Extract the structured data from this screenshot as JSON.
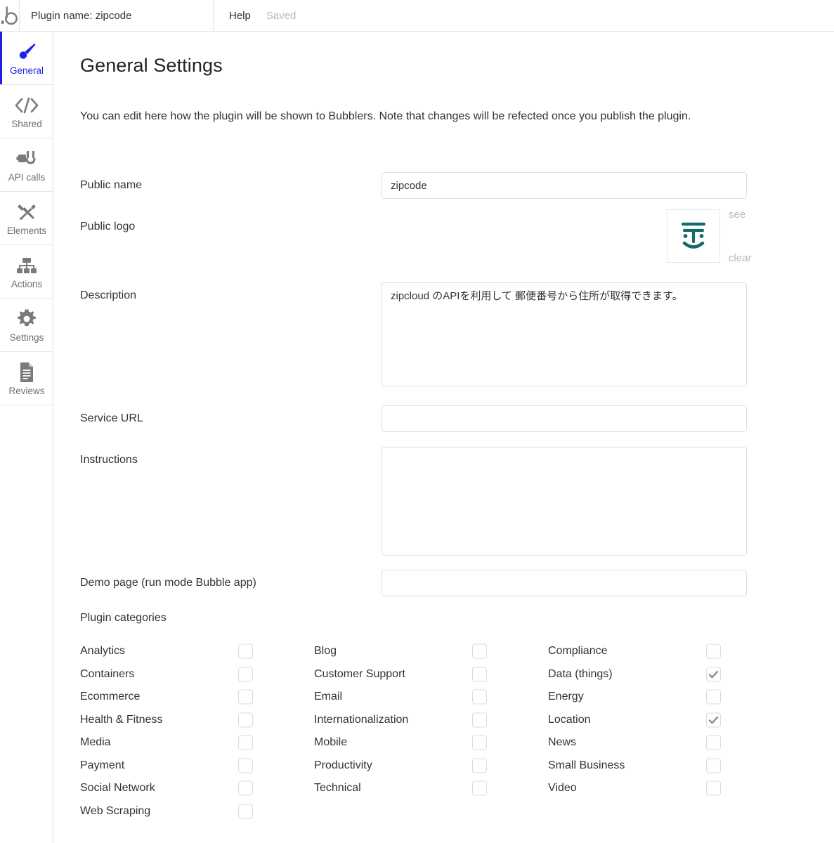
{
  "topbar": {
    "brand_icon": "bubble-b-logo",
    "plugin_name": "Plugin name: zipcode",
    "help_label": "Help",
    "saved_status": "Saved"
  },
  "sidebar": {
    "items": [
      {
        "label": "General",
        "icon": "paintbrush-icon",
        "active": true
      },
      {
        "label": "Shared",
        "icon": "code-brackets-icon",
        "active": false
      },
      {
        "label": "API calls",
        "icon": "plug-icon",
        "active": false
      },
      {
        "label": "Elements",
        "icon": "tools-icon",
        "active": false
      },
      {
        "label": "Actions",
        "icon": "hierarchy-icon",
        "active": false
      },
      {
        "label": "Settings",
        "icon": "gear-icon",
        "active": false
      },
      {
        "label": "Reviews",
        "icon": "document-icon",
        "active": false
      }
    ]
  },
  "main": {
    "title": "General Settings",
    "description": "You can edit here how the plugin will be shown to Bubblers. Note that changes will be refected once you publish the plugin.",
    "fields": {
      "public_name": {
        "label": "Public name",
        "value": "zipcode",
        "placeholder": ""
      },
      "public_logo": {
        "label": "Public logo",
        "see_label": "see",
        "clear_label": "clear",
        "icon": "zipcloud-face-logo",
        "color": "#146b6b"
      },
      "description": {
        "label": "Description",
        "value": "zipcloud のAPIを利用して 郵便番号から住所が取得できます。",
        "placeholder": ""
      },
      "service_url": {
        "label": "Service URL",
        "value": "",
        "placeholder": ""
      },
      "instructions": {
        "label": "Instructions",
        "value": "",
        "placeholder": ""
      },
      "demo_page": {
        "label": "Demo page (run mode Bubble app)",
        "value": "",
        "placeholder": ""
      }
    },
    "categories": {
      "title": "Plugin categories",
      "columns": [
        [
          {
            "label": "Analytics",
            "checked": false
          },
          {
            "label": "Containers",
            "checked": false
          },
          {
            "label": "Ecommerce",
            "checked": false
          },
          {
            "label": "Health & Fitness",
            "checked": false
          },
          {
            "label": "Media",
            "checked": false
          },
          {
            "label": "Payment",
            "checked": false
          },
          {
            "label": "Social Network",
            "checked": false
          },
          {
            "label": "Web Scraping",
            "checked": false
          }
        ],
        [
          {
            "label": "Blog",
            "checked": false
          },
          {
            "label": "Customer Support",
            "checked": false
          },
          {
            "label": "Email",
            "checked": false
          },
          {
            "label": "Internationalization",
            "checked": false
          },
          {
            "label": "Mobile",
            "checked": false
          },
          {
            "label": "Productivity",
            "checked": false
          },
          {
            "label": "Technical",
            "checked": false
          }
        ],
        [
          {
            "label": "Compliance",
            "checked": false
          },
          {
            "label": "Data (things)",
            "checked": true
          },
          {
            "label": "Energy",
            "checked": false
          },
          {
            "label": "Location",
            "checked": true
          },
          {
            "label": "News",
            "checked": false
          },
          {
            "label": "Small Business",
            "checked": false
          },
          {
            "label": "Video",
            "checked": false
          }
        ]
      ]
    }
  },
  "colors": {
    "accent_blue": "#1d22e0",
    "logo_teal": "#146b6b",
    "muted_gray": "#b9b9b9",
    "border_gray": "#e0e0e0"
  }
}
